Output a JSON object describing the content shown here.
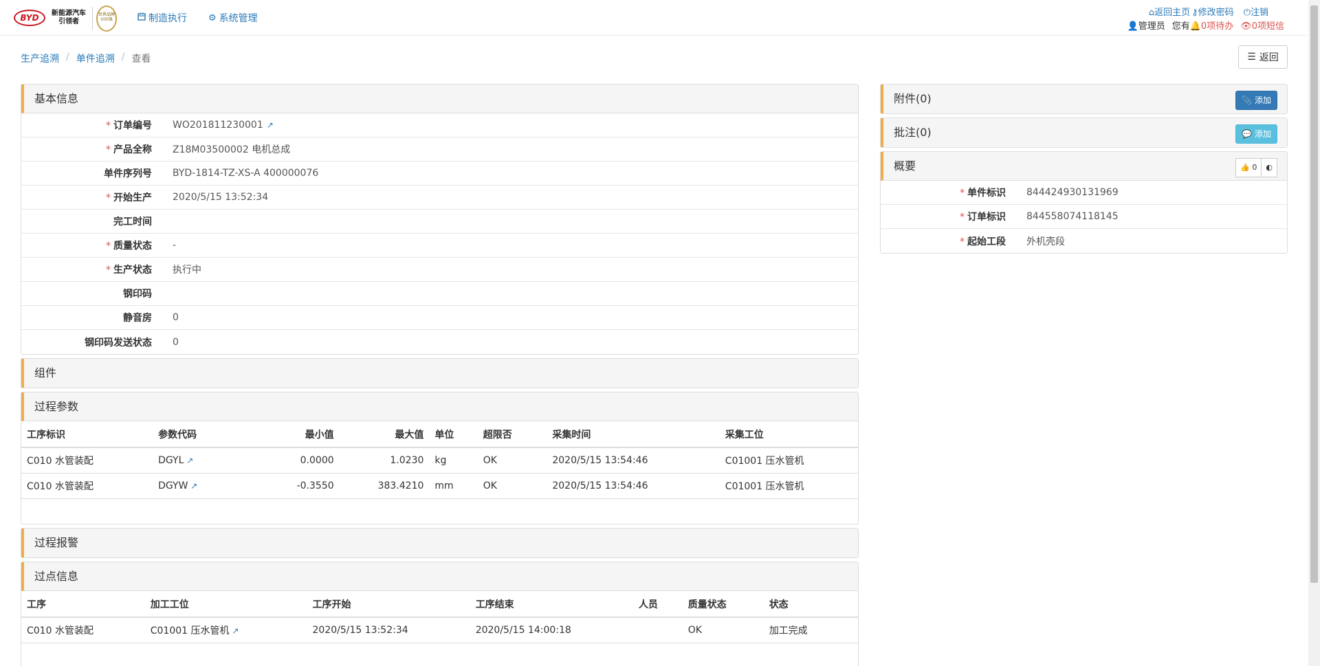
{
  "nav": {
    "logo_text_1": "新能源汽车",
    "logo_text_2": "引领者",
    "byd": "BYD",
    "badge": "世界品牌500强",
    "items": [
      {
        "label": "制造执行",
        "icon": "calendar-icon"
      },
      {
        "label": "系统管理",
        "icon": "gear-icon"
      }
    ],
    "home": "返回主页",
    "change_password": "修改密码",
    "logout": "注销",
    "user": "管理员",
    "you_have": "您有",
    "todo": "0项待办",
    "sms": "0项短信"
  },
  "breadcrumb": [
    "生产追溯",
    "单件追溯",
    "查看"
  ],
  "back_label": "返回",
  "basic": {
    "title": "基本信息",
    "rows": [
      {
        "label": "订单编号",
        "required": true,
        "value": "WO201811230001",
        "link": true
      },
      {
        "label": "产品全称",
        "required": true,
        "value": "Z18M03500002 电机总成",
        "link": false
      },
      {
        "label": "单件序列号",
        "required": false,
        "value": "BYD-1814-TZ-XS-A 400000076",
        "link": false
      },
      {
        "label": "开始生产",
        "required": true,
        "value": "2020/5/15 13:52:34",
        "link": false
      },
      {
        "label": "完工时间",
        "required": false,
        "value": "",
        "link": false
      },
      {
        "label": "质量状态",
        "required": true,
        "value": "-",
        "link": false
      },
      {
        "label": "生产状态",
        "required": true,
        "value": "执行中",
        "link": false
      },
      {
        "label": "钢印码",
        "required": false,
        "value": "",
        "link": false
      },
      {
        "label": "静音房",
        "required": false,
        "value": "0",
        "link": false
      },
      {
        "label": "钢印码发送状态",
        "required": false,
        "value": "0",
        "link": false
      }
    ]
  },
  "components": {
    "title": "组件"
  },
  "params": {
    "title": "过程参数",
    "headers": [
      "工序标识",
      "参数代码",
      "最小值",
      "最大值",
      "单位",
      "超限否",
      "采集时间",
      "采集工位"
    ],
    "rows": [
      [
        "C010 水管装配",
        "DGYL",
        "0.0000",
        "1.0230",
        "kg",
        "OK",
        "2020/5/15 13:54:46",
        "C01001 压水管机"
      ],
      [
        "C010 水管装配",
        "DGYW",
        "-0.3550",
        "383.4210",
        "mm",
        "OK",
        "2020/5/15 13:54:46",
        "C01001 压水管机"
      ]
    ]
  },
  "alarms": {
    "title": "过程报警"
  },
  "points": {
    "title": "过点信息",
    "headers": [
      "工序",
      "加工工位",
      "工序开始",
      "工序结束",
      "人员",
      "质量状态",
      "状态"
    ],
    "rows": [
      [
        "C010 水管装配",
        "C01001 压水管机",
        "2020/5/15 13:52:34",
        "2020/5/15 14:00:18",
        "",
        "OK",
        "加工完成"
      ]
    ]
  },
  "attachments": {
    "title": "附件(0)",
    "add": "添加"
  },
  "notes": {
    "title": "批注(0)",
    "add": "添加"
  },
  "summary": {
    "title": "概要",
    "likes": "0",
    "rows": [
      {
        "label": "单件标识",
        "value": "844424930131969"
      },
      {
        "label": "订单标识",
        "value": "844558074118145"
      },
      {
        "label": "起始工段",
        "value": "外机壳段"
      }
    ]
  }
}
